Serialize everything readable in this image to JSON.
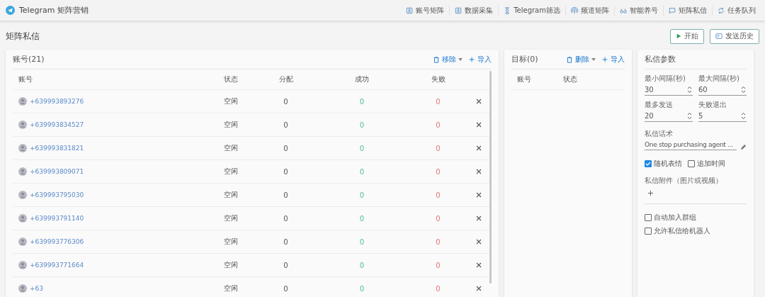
{
  "app": {
    "title": "Telegram 矩阵营销"
  },
  "nav": [
    {
      "label": "账号矩阵",
      "selected": false
    },
    {
      "label": "数据采集",
      "selected": false
    },
    {
      "label": "Telegram筛选",
      "selected": false
    },
    {
      "label": "频道矩阵",
      "selected": false
    },
    {
      "label": "智能养号",
      "selected": false
    },
    {
      "label": "矩阵私信",
      "selected": false
    },
    {
      "label": "任务队列",
      "selected": false
    }
  ],
  "page": {
    "title": "矩阵私信",
    "buttons": [
      {
        "label": "开始"
      },
      {
        "label": "发送历史"
      }
    ]
  },
  "accounts": {
    "title": "账号(21)",
    "actions": [
      {
        "label": "移除",
        "dropdown": true
      },
      {
        "label": "导入",
        "dropdown": false
      }
    ],
    "columns": [
      "账号",
      "状态",
      "分配",
      "成功",
      "失败"
    ],
    "rows": [
      {
        "phone": "+639993893276",
        "status": "空闲",
        "assigned": "0",
        "success": "0",
        "failed": "0"
      },
      {
        "phone": "+639993834527",
        "status": "空闲",
        "assigned": "0",
        "success": "0",
        "failed": "0"
      },
      {
        "phone": "+639993831821",
        "status": "空闲",
        "assigned": "0",
        "success": "0",
        "failed": "0"
      },
      {
        "phone": "+639993809071",
        "status": "空闲",
        "assigned": "0",
        "success": "0",
        "failed": "0"
      },
      {
        "phone": "+639993795030",
        "status": "空闲",
        "assigned": "0",
        "success": "0",
        "failed": "0"
      },
      {
        "phone": "+639993791140",
        "status": "空闲",
        "assigned": "0",
        "success": "0",
        "failed": "0"
      },
      {
        "phone": "+639993776306",
        "status": "空闲",
        "assigned": "0",
        "success": "0",
        "failed": "0"
      },
      {
        "phone": "+639993771664",
        "status": "空闲",
        "assigned": "0",
        "success": "0",
        "failed": "0"
      },
      {
        "phone": "+63",
        "status": "空闲",
        "assigned": "0",
        "success": "0",
        "failed": "0"
      }
    ]
  },
  "targets": {
    "title": "目标(0)",
    "actions": [
      {
        "label": "删除",
        "dropdown": true
      },
      {
        "label": "导入",
        "dropdown": false
      }
    ],
    "columns": [
      "账号",
      "状态"
    ]
  },
  "params": {
    "title": "私信参数",
    "numbers": [
      {
        "label": "最小间隔(秒)",
        "value": "30"
      },
      {
        "label": "最大间隔(秒)",
        "value": "60"
      },
      {
        "label": "最多发送",
        "value": "20"
      },
      {
        "label": "失败退出",
        "value": "5"
      }
    ],
    "script": {
      "label": "私信话术",
      "value": "One stop purchasing agent ..."
    },
    "options": [
      {
        "label": "随机表情",
        "checked": true
      },
      {
        "label": "追加时间",
        "checked": false
      }
    ],
    "attachment": {
      "label": "私信附件（图片或视频）"
    },
    "options2": [
      {
        "label": "自动加入群组",
        "checked": false
      },
      {
        "label": "允许私信给机器人",
        "checked": false
      }
    ]
  }
}
